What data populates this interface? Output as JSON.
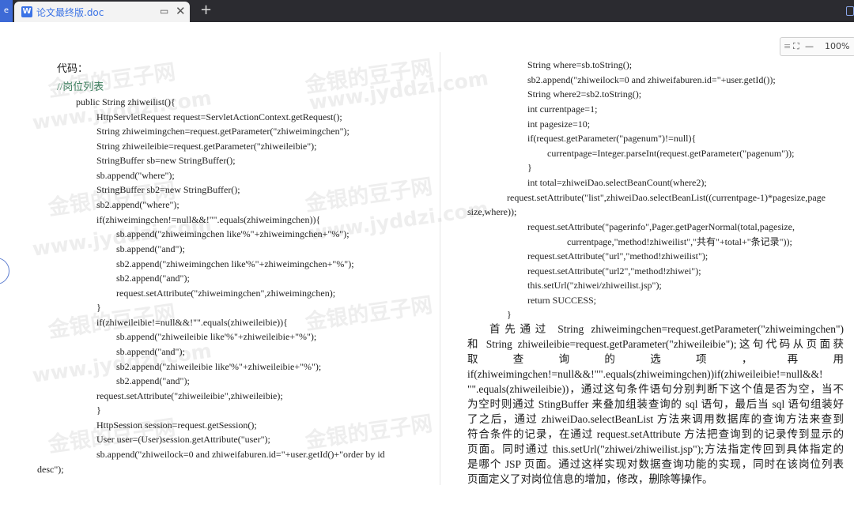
{
  "tabbar": {
    "tab_title": "论文最终版.doc",
    "new_tab": "+",
    "restore_symbol": "▭",
    "close_symbol": "✕",
    "app_icon_letter": "e",
    "doc_icon_letter": "W"
  },
  "zoom": {
    "mode_icon": "⛶",
    "minus": "—",
    "value": "100%"
  },
  "watermark": {
    "brand": "金银的豆子网",
    "url": "www.jyddzi.com"
  },
  "document": {
    "left_lines": [
      "代码：",
      "//岗位列表",
      "public String zhiweilist(){",
      "HttpServletRequest request=ServletActionContext.getRequest();",
      "String zhiweimingchen=request.getParameter(\"zhiweimingchen\");",
      "String zhiweileibie=request.getParameter(\"zhiweileibie\");",
      "StringBuffer sb=new StringBuffer();",
      "sb.append(\"where\");",
      "StringBuffer sb2=new StringBuffer();",
      "sb2.append(\"where\");",
      "if(zhiweimingchen!=null&&!\"\".equals(zhiweimingchen)){",
      "sb.append(\"zhiweimingchen like'%\"+zhiweimingchen+\"%\");",
      "sb.append(\"and\");",
      "sb2.append(\"zhiweimingchen like'%\"+zhiweimingchen+\"%\");",
      "sb2.append(\"and\");",
      "request.setAttribute(\"zhiweimingchen\",zhiweimingchen);",
      "}",
      "if(zhiweileibie!=null&&!\"\".equals(zhiweileibie)){",
      "sb.append(\"zhiweileibie like'%\"+zhiweileibie+\"%\");",
      "sb.append(\"and\");",
      "sb2.append(\"zhiweileibie like'%\"+zhiweileibie+\"%\");",
      "sb2.append(\"and\");",
      "request.setAttribute(\"zhiweileibie\",zhiweileibie);",
      "}",
      "HttpSession session=request.getSession();",
      "User user=(User)session.getAttribute(\"user\");",
      "sb.append(\"zhiweilock=0 and zhiweifaburen.id=\"+user.getId()+\"order by id",
      "desc\");"
    ],
    "right_lines": [
      "String where=sb.toString();",
      "sb2.append(\"zhiweilock=0 and zhiweifaburen.id=\"+user.getId());",
      "String where2=sb2.toString();",
      "int currentpage=1;",
      "int pagesize=10;",
      "if(request.getParameter(\"pagenum\")!=null){",
      "currentpage=Integer.parseInt(request.getParameter(\"pagenum\"));",
      "}",
      "int total=zhiweiDao.selectBeanCount(where2);",
      "request.setAttribute(\"list\",zhiweiDao.selectBeanList((currentpage-1)*pagesize,page",
      "size,where));",
      "request.setAttribute(\"pagerinfo\",Pager.getPagerNormal(total,pagesize,",
      "currentpage,\"method!zhiweilist\",\"共有\"+total+\"条记录\"));",
      "request.setAttribute(\"url\",\"method!zhiweilist\");",
      "request.setAttribute(\"url2\",\"method!zhiwei\");",
      "this.setUrl(\"zhiwei/zhiweilist.jsp\");",
      "return SUCCESS;",
      "}"
    ],
    "paragraph_lines": [
      "首先通过 String zhiweimingchen=request.getParameter(\"zhiweimingchen\")",
      "和 String zhiweileibie=request.getParameter(\"zhiweileibie\");这句代码从页面获",
      "取 查 询 的 选 项 ， 再 用",
      "if(zhiweimingchen!=null&&!\"\".equals(zhiweimingchen))if(zhiweileibie!=null&&!",
      "\"\".equals(zhiweileibie))，通过这句条件语句分别判断下这个值是否为空，当不",
      "为空时则通过 StingBuffer 来叠加组装查询的 sql 语句，最后当 sql 语句组装好",
      "了之后，通过 zhiweiDao.selectBeanList 方法来调用数据库的查询方法来查到",
      "符合条件的记录，在通过 request.setAttribute 方法把查询到的记录传到显示的",
      "页面。同时通过 this.setUrl(\"zhiwei/zhiweilist.jsp\");方法指定传回到具体指定的",
      "是哪个 JSP 页面。通过这样实现对数据查询功能的实现，同时在该岗位列表",
      "页面定义了对岗位信息的增加，修改，删除等操作。"
    ]
  }
}
